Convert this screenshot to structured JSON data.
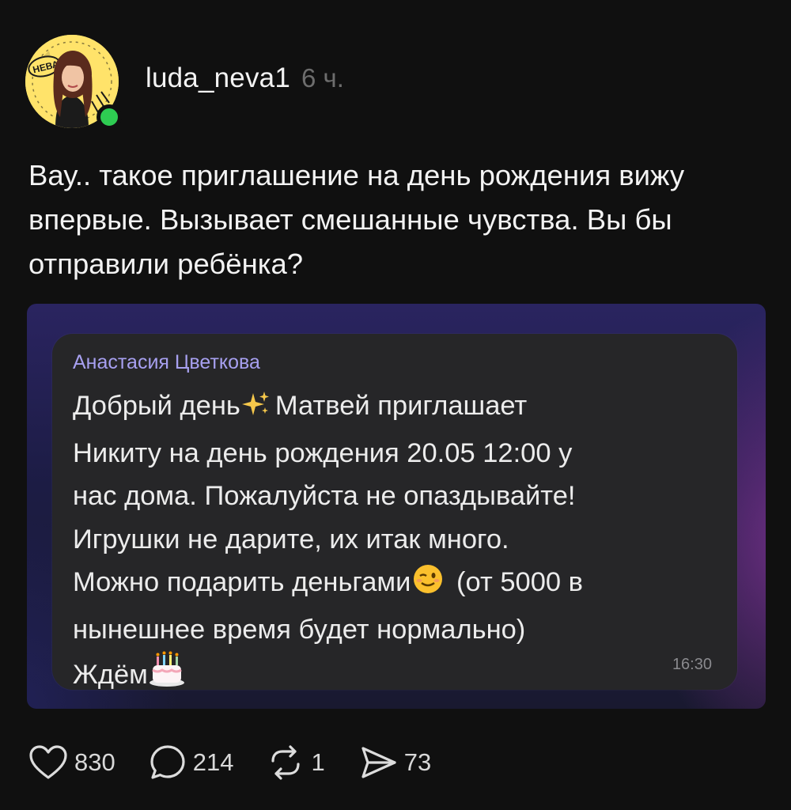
{
  "post": {
    "username": "luda_neva1",
    "time_ago": "6 ч.",
    "text": "Вау.. такое приглашение на день рождения вижу впервые. Вызывает смешанные чувства. Вы бы отправили ребёнка?",
    "avatar_badge_text": "НЕВА"
  },
  "screenshot": {
    "sender": "Анастасия Цветкова",
    "lines": {
      "l1a": "Добрый день",
      "l1b": "Матвей приглашает",
      "l2": "Никиту на день  рождения 20.05 12:00 у",
      "l3": "нас дома. Пожалуйста не опаздывайте!",
      "l4": "Игрушки не дарите, их итак много.",
      "l5a": "Можно подарить деньгами",
      "l5b": "(от 5000 в",
      "l6": "нынешнее время будет нормально)",
      "l7": "Ждём"
    },
    "time": "16:30",
    "emojis": [
      "sparkles",
      "winking-face",
      "birthday-cake"
    ]
  },
  "actions": {
    "likes": "830",
    "comments": "214",
    "reposts": "1",
    "shares": "73"
  },
  "colors": {
    "background": "#101010",
    "online": "#2ecc52",
    "sender": "#a7a0f0",
    "bubble": "#262628"
  }
}
